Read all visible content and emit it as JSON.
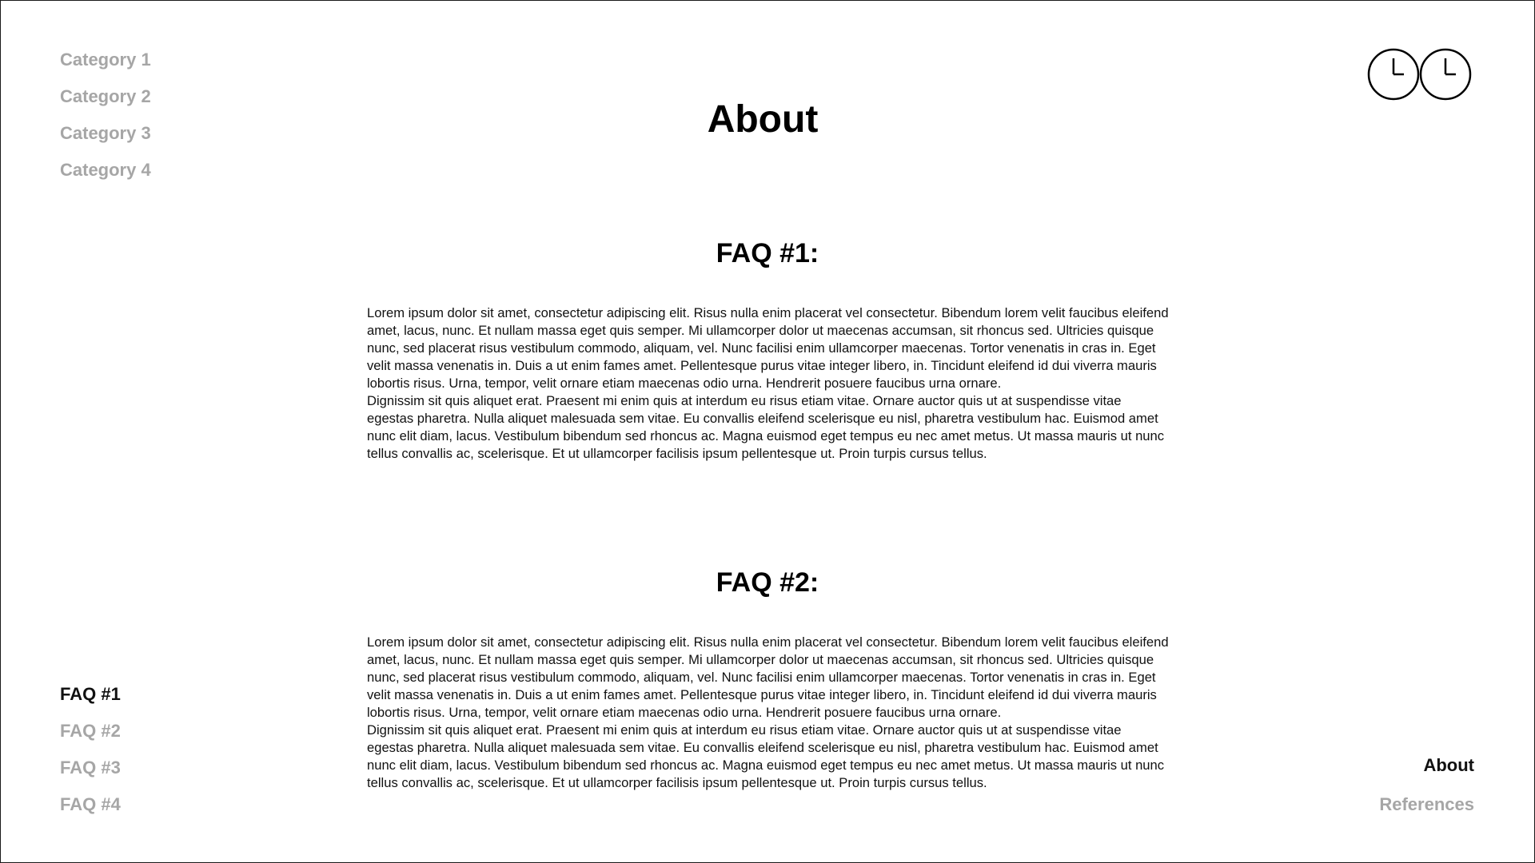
{
  "categories": [
    "Category 1",
    "Category 2",
    "Category 3",
    "Category 4"
  ],
  "title": "About",
  "faqs": [
    {
      "heading": "FAQ #1:",
      "paragraphs": [
        "Lorem ipsum dolor sit amet, consectetur adipiscing elit. Risus nulla enim placerat vel consectetur. Bibendum lorem velit faucibus eleifend amet, lacus, nunc. Et nullam massa eget quis semper. Mi ullamcorper dolor ut maecenas accumsan, sit rhoncus sed. Ultricies quisque nunc, sed placerat risus vestibulum commodo, aliquam, vel. Nunc facilisi enim ullamcorper maecenas. Tortor venenatis in cras in. Eget velit massa venenatis in. Duis a ut enim fames amet. Pellentesque purus vitae integer libero, in. Tincidunt eleifend id dui viverra mauris lobortis risus. Urna, tempor, velit ornare etiam maecenas odio urna. Hendrerit posuere faucibus urna ornare.",
        "Dignissim sit quis aliquet erat. Praesent mi enim quis at interdum eu risus etiam vitae. Ornare auctor quis ut at suspendisse vitae egestas pharetra. Nulla aliquet malesuada sem vitae. Eu convallis eleifend scelerisque eu nisl, pharetra vestibulum hac. Euismod amet nunc elit diam, lacus. Vestibulum bibendum sed rhoncus ac. Magna euismod eget tempus eu nec amet metus. Ut massa mauris ut nunc tellus convallis ac, scelerisque. Et ut ullamcorper facilisis ipsum pellentesque ut. Proin turpis cursus tellus."
      ]
    },
    {
      "heading": "FAQ #2:",
      "paragraphs": [
        "Lorem ipsum dolor sit amet, consectetur adipiscing elit. Risus nulla enim placerat vel consectetur. Bibendum lorem velit faucibus eleifend amet, lacus, nunc. Et nullam massa eget quis semper. Mi ullamcorper dolor ut maecenas accumsan, sit rhoncus sed. Ultricies quisque nunc, sed placerat risus vestibulum commodo, aliquam, vel. Nunc facilisi enim ullamcorper maecenas. Tortor venenatis in cras in. Eget velit massa venenatis in. Duis a ut enim fames amet. Pellentesque purus vitae integer libero, in. Tincidunt eleifend id dui viverra mauris lobortis risus. Urna, tempor, velit ornare etiam maecenas odio urna. Hendrerit posuere faucibus urna ornare.",
        "Dignissim sit quis aliquet erat. Praesent mi enim quis at interdum eu risus etiam vitae. Ornare auctor quis ut at suspendisse vitae egestas pharetra. Nulla aliquet malesuada sem vitae. Eu convallis eleifend scelerisque eu nisl, pharetra vestibulum hac. Euismod amet nunc elit diam, lacus. Vestibulum bibendum sed rhoncus ac. Magna euismod eget tempus eu nec amet metus. Ut massa mauris ut nunc tellus convallis ac, scelerisque. Et ut ullamcorper facilisis ipsum pellentesque ut. Proin turpis cursus tellus."
      ]
    }
  ],
  "faq_nav": {
    "items": [
      "FAQ #1",
      "FAQ #2",
      "FAQ #3",
      "FAQ #4"
    ],
    "active": "FAQ #1"
  },
  "page_nav": {
    "items": [
      "About",
      "References"
    ],
    "active": "About"
  },
  "logo": {
    "icon": "twin-clock-logo-icon"
  },
  "colors": {
    "text": "#111111",
    "muted": "#a6a6a6",
    "background": "#ffffff",
    "border": "#1a1a1a"
  }
}
